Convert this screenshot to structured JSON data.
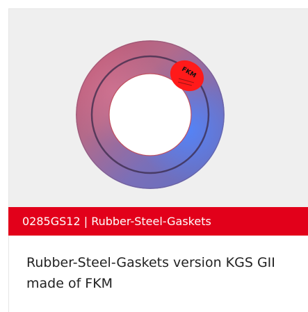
{
  "product": {
    "banner_text": "0285GS12 | Rubber-Steel-Gaskets",
    "description": "Rubber-Steel-Gaskets version KGS GII made of FKM",
    "label_badge": "FKM"
  },
  "colors": {
    "banner_bg": "#e2001a",
    "image_bg": "#efefef",
    "text": "#222222"
  }
}
